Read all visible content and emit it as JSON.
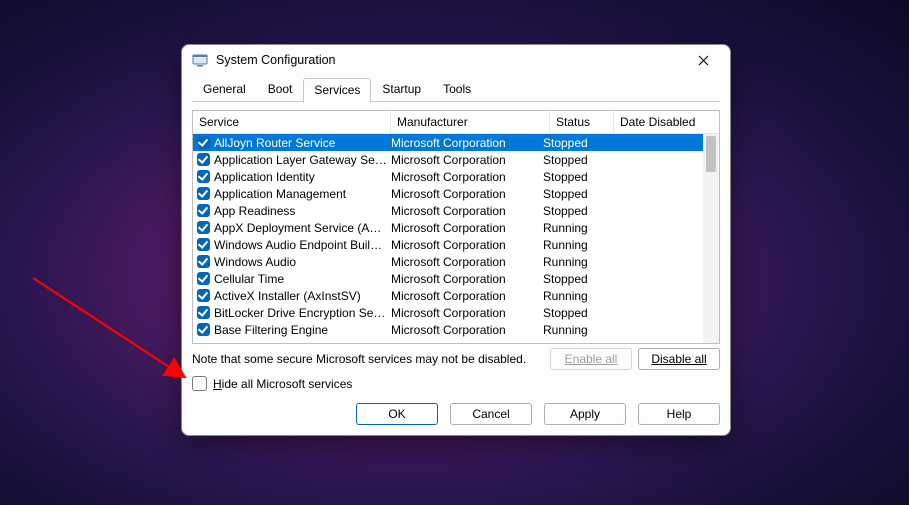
{
  "window": {
    "title": "System Configuration"
  },
  "tabs": [
    {
      "label": "General",
      "active": false
    },
    {
      "label": "Boot",
      "active": false
    },
    {
      "label": "Services",
      "active": true
    },
    {
      "label": "Startup",
      "active": false
    },
    {
      "label": "Tools",
      "active": false
    }
  ],
  "columns": {
    "service": "Service",
    "manufacturer": "Manufacturer",
    "status": "Status",
    "date_disabled": "Date Disabled"
  },
  "services": [
    {
      "name": "AllJoyn Router Service",
      "manufacturer": "Microsoft Corporation",
      "status": "Stopped",
      "selected": true
    },
    {
      "name": "Application Layer Gateway Service",
      "manufacturer": "Microsoft Corporation",
      "status": "Stopped"
    },
    {
      "name": "Application Identity",
      "manufacturer": "Microsoft Corporation",
      "status": "Stopped"
    },
    {
      "name": "Application Management",
      "manufacturer": "Microsoft Corporation",
      "status": "Stopped"
    },
    {
      "name": "App Readiness",
      "manufacturer": "Microsoft Corporation",
      "status": "Stopped"
    },
    {
      "name": "AppX Deployment Service (AppX...",
      "manufacturer": "Microsoft Corporation",
      "status": "Running"
    },
    {
      "name": "Windows Audio Endpoint Builder",
      "manufacturer": "Microsoft Corporation",
      "status": "Running"
    },
    {
      "name": "Windows Audio",
      "manufacturer": "Microsoft Corporation",
      "status": "Running"
    },
    {
      "name": "Cellular Time",
      "manufacturer": "Microsoft Corporation",
      "status": "Stopped"
    },
    {
      "name": "ActiveX Installer (AxInstSV)",
      "manufacturer": "Microsoft Corporation",
      "status": "Running"
    },
    {
      "name": "BitLocker Drive Encryption Service",
      "manufacturer": "Microsoft Corporation",
      "status": "Stopped"
    },
    {
      "name": "Base Filtering Engine",
      "manufacturer": "Microsoft Corporation",
      "status": "Running"
    }
  ],
  "note": "Note that some secure Microsoft services may not be disabled.",
  "buttons": {
    "enable_all": "Enable all",
    "disable_all": "Disable all",
    "ok": "OK",
    "cancel": "Cancel",
    "apply": "Apply",
    "help": "Help"
  },
  "hide_checkbox_label_pre": "H",
  "hide_checkbox_label_post": "ide all Microsoft services"
}
